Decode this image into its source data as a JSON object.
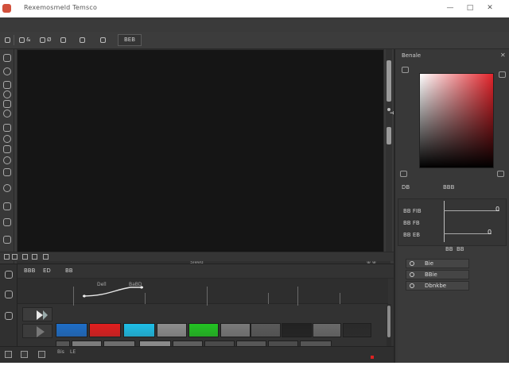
{
  "titlebar": {
    "title": "Rexemosmeld Temsco",
    "minimize": "—",
    "maximize": "□",
    "close": "✕"
  },
  "toolbar": {
    "items": [
      {
        "label": "&",
        "icon": "toolbar-icon"
      },
      {
        "label": "Ø",
        "icon": "toolbar-icon"
      },
      {
        "label": "",
        "icon": "toolbar-icon"
      },
      {
        "label": "",
        "icon": "toolbar-icon"
      },
      {
        "label": "",
        "icon": "toolbar-icon"
      }
    ],
    "field_value": "BEB"
  },
  "canvas": {
    "status_center": "Sleed",
    "status_right": "⊕ ⊕"
  },
  "timeline": {
    "header": [
      "BBB",
      "ED",
      "BB"
    ],
    "ruler_labels": [
      "Dell",
      "BaBD"
    ],
    "clip_colors_row1": [
      "#1e6ec8",
      "#e21e1e",
      "#1ebfe8",
      "#8e8e8e",
      "#22c322",
      "#7a7a7a",
      "#5a5a5a",
      "#222222",
      "#6a6a6a",
      "#2a2a2a"
    ],
    "clip_colors_row2": [
      "#555555",
      "#7c7c7c",
      "#6e6e6e",
      "#8a8a8a",
      "#5e5e5e",
      "#4a4a4a",
      "#575757",
      "#4c4c4c",
      "#555555"
    ],
    "footer_labels": [
      "Bis",
      "LE"
    ]
  },
  "rightpanel": {
    "title": "Benale",
    "close": "✕",
    "below_labels": [
      "DB",
      "BBB"
    ],
    "rows": [
      {
        "label": "BB FIB",
        "value": "0"
      },
      {
        "label": "BB EB",
        "value": "0"
      }
    ],
    "rows_small": [
      {
        "label": "BB FB"
      }
    ],
    "bar_labels": [
      "BB",
      "BB"
    ],
    "layers": [
      {
        "name": "Bie"
      },
      {
        "name": "BBie"
      },
      {
        "name": "Dbnkbe"
      }
    ],
    "accent_color": "#e3242b"
  }
}
